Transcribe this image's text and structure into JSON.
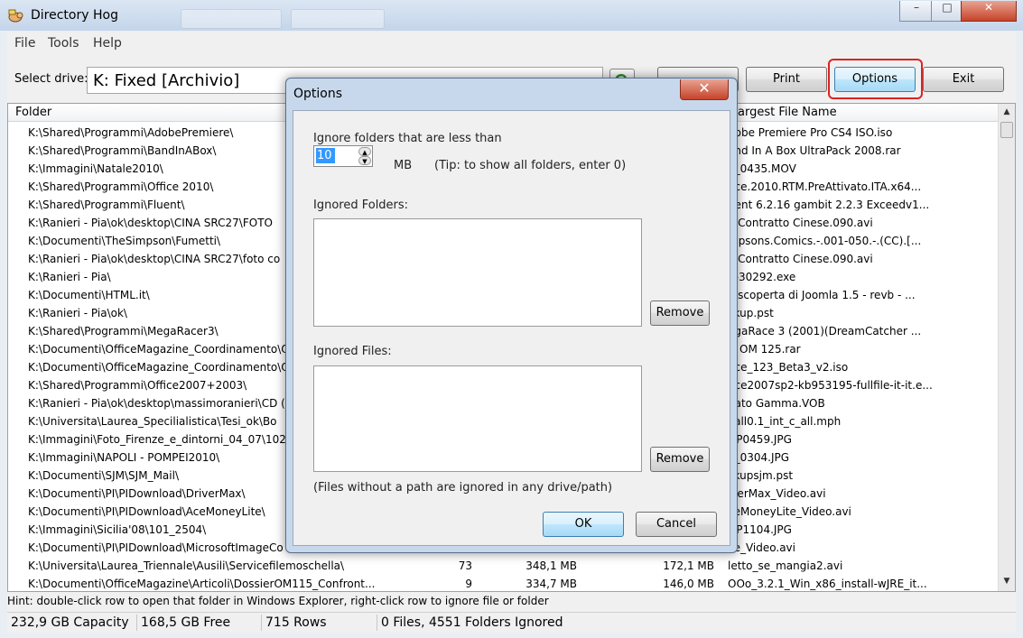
{
  "window": {
    "title": "Directory Hog",
    "controls": {
      "minimize": "–",
      "maximize": "□",
      "close": "✕"
    }
  },
  "menu": [
    "File",
    "Tools",
    "Help"
  ],
  "toolbar": {
    "select_drive_label": "Select drive:",
    "drive_value": "K: Fixed [Archivio]",
    "print_label": "Print",
    "options_label": "Options",
    "exit_label": "Exit"
  },
  "list": {
    "headers": {
      "folder": "Folder",
      "largest_file_name": "argest File Name"
    },
    "rows": [
      {
        "folder": "K:\\Shared\\Programmi\\AdobePremiere\\",
        "files": "",
        "size": "",
        "largest": "",
        "name": "dobe Premiere Pro CS4 ISO.iso"
      },
      {
        "folder": "K:\\Shared\\Programmi\\BandInABox\\",
        "files": "",
        "size": "",
        "largest": "",
        "name": "and In A Box UltraPack 2008.rar"
      },
      {
        "folder": "K:\\Immagini\\Natale2010\\",
        "files": "",
        "size": "",
        "largest": "",
        "name": "0_0435.MOV"
      },
      {
        "folder": "K:\\Shared\\Programmi\\Office 2010\\",
        "files": "",
        "size": "",
        "largest": "",
        "name": "fice.2010.RTM.PreAttivato.ITA.x64..."
      },
      {
        "folder": "K:\\Shared\\Programmi\\Fluent\\",
        "files": "",
        "size": "",
        "largest": "",
        "name": "uent 6.2.16 gambit 2.2.3 Exceedv1..."
      },
      {
        "folder": "K:\\Ranieri - Pia\\ok\\desktop\\CINA SRC27\\FOTO",
        "files": "",
        "size": "",
        "largest": "",
        "name": "o Contratto Cinese.090.avi"
      },
      {
        "folder": "K:\\Documenti\\TheSimpson\\Fumetti\\",
        "files": "",
        "size": "",
        "largest": "",
        "name": "mpsons.Comics.-.001-050.-.(CC).[..."
      },
      {
        "folder": "K:\\Ranieri - Pia\\ok\\desktop\\CINA SRC27\\foto co",
        "files": "",
        "size": "",
        "largest": "",
        "name": "o Contratto Cinese.090.avi"
      },
      {
        "folder": "K:\\Ranieri - Pia\\",
        "files": "",
        "size": "",
        "largest": "",
        "name": "2-30292.exe"
      },
      {
        "folder": "K:\\Documenti\\HTML.it\\",
        "files": "",
        "size": "",
        "largest": "",
        "name": "a scoperta di Joomla 1.5 - revb - ..."
      },
      {
        "folder": "K:\\Ranieri - Pia\\ok\\",
        "files": "",
        "size": "",
        "largest": "",
        "name": "ckup.pst"
      },
      {
        "folder": "K:\\Shared\\Programmi\\MegaRacer3\\",
        "files": "",
        "size": "",
        "largest": "",
        "name": "egaRace 3 (2001)(DreamCatcher ..."
      },
      {
        "folder": "K:\\Documenti\\OfficeMagazine_Coordinamento\\O",
        "files": "",
        "size": "",
        "largest": "",
        "name": "D OM 125.rar"
      },
      {
        "folder": "K:\\Documenti\\OfficeMagazine_Coordinamento\\O",
        "files": "",
        "size": "",
        "largest": "",
        "name": "fice_123_Beta3_v2.iso"
      },
      {
        "folder": "K:\\Shared\\Programmi\\Office2007+2003\\",
        "files": "",
        "size": "",
        "largest": "",
        "name": "fice2007sp2-kb953195-fullfile-it-it.e..."
      },
      {
        "folder": "K:\\Ranieri - Pia\\ok\\desktop\\massimoranieri\\CD (",
        "files": "",
        "size": "",
        "largest": "",
        "name": "nato Gamma.VOB"
      },
      {
        "folder": "K:\\Universita\\Laurea_Specilialistica\\Tesi_ok\\Bo",
        "files": "",
        "size": "",
        "largest": "",
        "name": "vall0.1_int_c_all.mph"
      },
      {
        "folder": "K:\\Immagini\\Foto_Firenze_e_dintorni_04_07\\102_",
        "files": "",
        "size": "",
        "largest": "",
        "name": "GP0459.JPG"
      },
      {
        "folder": "K:\\Immagini\\NAPOLI - POMPEI2010\\",
        "files": "",
        "size": "",
        "largest": "",
        "name": "0_0304.JPG"
      },
      {
        "folder": "K:\\Documenti\\SJM\\SJM_Mail\\",
        "files": "",
        "size": "",
        "largest": "",
        "name": "ckupsjm.pst"
      },
      {
        "folder": "K:\\Documenti\\PI\\PIDownload\\DriverMax\\",
        "files": "",
        "size": "",
        "largest": "",
        "name": "iverMax_Video.avi"
      },
      {
        "folder": "K:\\Documenti\\PI\\PIDownload\\AceMoneyLite\\",
        "files": "",
        "size": "",
        "largest": "",
        "name": "ceMoneyLite_Video.avi"
      },
      {
        "folder": "K:\\Immagini\\Sicilia'08\\101_2504\\",
        "files": "",
        "size": "",
        "largest": "",
        "name": "GP1104.JPG"
      },
      {
        "folder": "K:\\Documenti\\PI\\PIDownload\\MicrosoftImageCo",
        "files": "",
        "size": "",
        "largest": "",
        "name": "ce_Video.avi"
      },
      {
        "folder": "K:\\Universita\\Laurea_Triennale\\Ausili\\Servicefilemoschella\\",
        "files": "73",
        "size": "348,1 MB",
        "largest": "172,1 MB",
        "name": "letto_se_mangia2.avi"
      },
      {
        "folder": "K:\\Documenti\\OfficeMagazine\\Articoli\\DossierOM115_Confront...",
        "files": "9",
        "size": "334,7 MB",
        "largest": "146,0 MB",
        "name": "OOo_3.2.1_Win_x86_install-wJRE_it..."
      }
    ]
  },
  "hint": "Hint: double-click row to open that folder in Windows Explorer, right-click row to ignore file or folder",
  "status": {
    "capacity": "232,9 GB Capacity",
    "free": "168,5 GB Free",
    "rows": "715 Rows",
    "ignored": "0 Files, 4551 Folders Ignored"
  },
  "dialog": {
    "title": "Options",
    "ignore_label": "Ignore folders that are less than",
    "threshold_value": "10",
    "unit": "MB",
    "tip": "(Tip: to show all folders, enter 0)",
    "ignored_folders_label": "Ignored Folders:",
    "ignored_files_label": "Ignored Files:",
    "remove_label": "Remove",
    "note": "(Files without a path are ignored in any drive/path)",
    "ok_label": "OK",
    "cancel_label": "Cancel"
  }
}
